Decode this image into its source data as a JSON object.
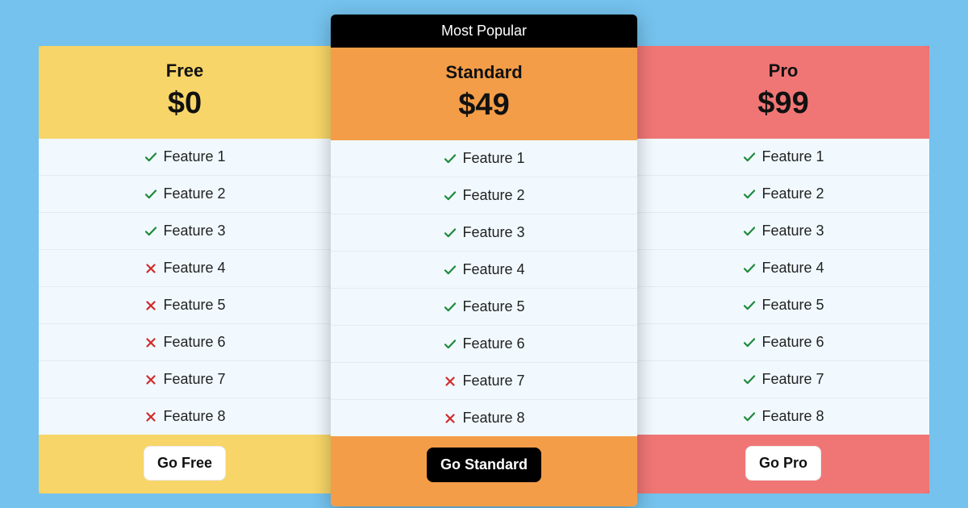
{
  "badge_label": "Most Popular",
  "plans": [
    {
      "id": "free",
      "name": "Free",
      "price": "$0",
      "cta": "Go Free",
      "featured": false,
      "features": [
        {
          "label": "Feature 1",
          "included": true
        },
        {
          "label": "Feature 2",
          "included": true
        },
        {
          "label": "Feature 3",
          "included": true
        },
        {
          "label": "Feature 4",
          "included": false
        },
        {
          "label": "Feature 5",
          "included": false
        },
        {
          "label": "Feature 6",
          "included": false
        },
        {
          "label": "Feature 7",
          "included": false
        },
        {
          "label": "Feature 8",
          "included": false
        }
      ]
    },
    {
      "id": "standard",
      "name": "Standard",
      "price": "$49",
      "cta": "Go Standard",
      "featured": true,
      "features": [
        {
          "label": "Feature 1",
          "included": true
        },
        {
          "label": "Feature 2",
          "included": true
        },
        {
          "label": "Feature 3",
          "included": true
        },
        {
          "label": "Feature 4",
          "included": true
        },
        {
          "label": "Feature 5",
          "included": true
        },
        {
          "label": "Feature 6",
          "included": true
        },
        {
          "label": "Feature 7",
          "included": false
        },
        {
          "label": "Feature 8",
          "included": false
        }
      ]
    },
    {
      "id": "pro",
      "name": "Pro",
      "price": "$99",
      "cta": "Go Pro",
      "featured": false,
      "features": [
        {
          "label": "Feature 1",
          "included": true
        },
        {
          "label": "Feature 2",
          "included": true
        },
        {
          "label": "Feature 3",
          "included": true
        },
        {
          "label": "Feature 4",
          "included": true
        },
        {
          "label": "Feature 5",
          "included": true
        },
        {
          "label": "Feature 6",
          "included": true
        },
        {
          "label": "Feature 7",
          "included": true
        },
        {
          "label": "Feature 8",
          "included": true
        }
      ]
    }
  ]
}
